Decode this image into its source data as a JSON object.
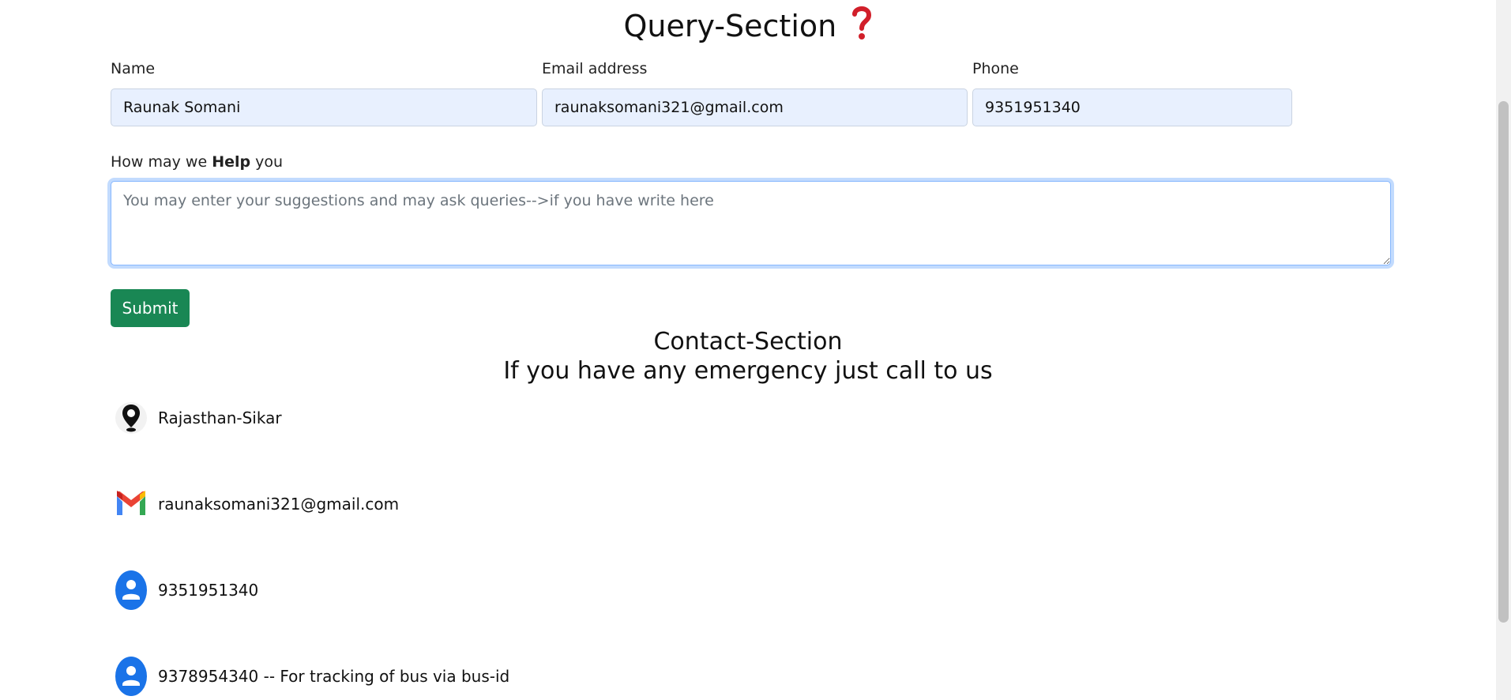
{
  "query_section": {
    "title": "Query-Section",
    "title_icon": "question-mark-icon",
    "name_label": "Name",
    "name_value": "Raunak Somani",
    "email_label": "Email address",
    "email_value": "raunaksomani321@gmail.com",
    "phone_label": "Phone",
    "phone_value": "9351951340",
    "help_label_prefix": "How may we ",
    "help_label_bold": "Help",
    "help_label_suffix": " you",
    "help_placeholder": "You may enter your suggestions and may ask queries-->if you have write here",
    "submit_label": "Submit"
  },
  "contact_section": {
    "title": "Contact-Section",
    "subtitle": "If you have any emergency just call to us",
    "items": [
      {
        "icon": "location-pin-icon",
        "text": "Rajasthan-Sikar"
      },
      {
        "icon": "gmail-icon",
        "text": "raunaksomani321@gmail.com"
      },
      {
        "icon": "contact-person-icon",
        "text": "9351951340"
      },
      {
        "icon": "contact-person-icon",
        "text": "9378954340 -- For tracking of bus via bus-id"
      }
    ]
  },
  "colors": {
    "submit_bg": "#198754",
    "input_bg": "#e8f0fe",
    "focus_ring": "#86b7fe",
    "question_mark": "#d11f2a",
    "contact_icon_blue": "#1a73e8"
  }
}
